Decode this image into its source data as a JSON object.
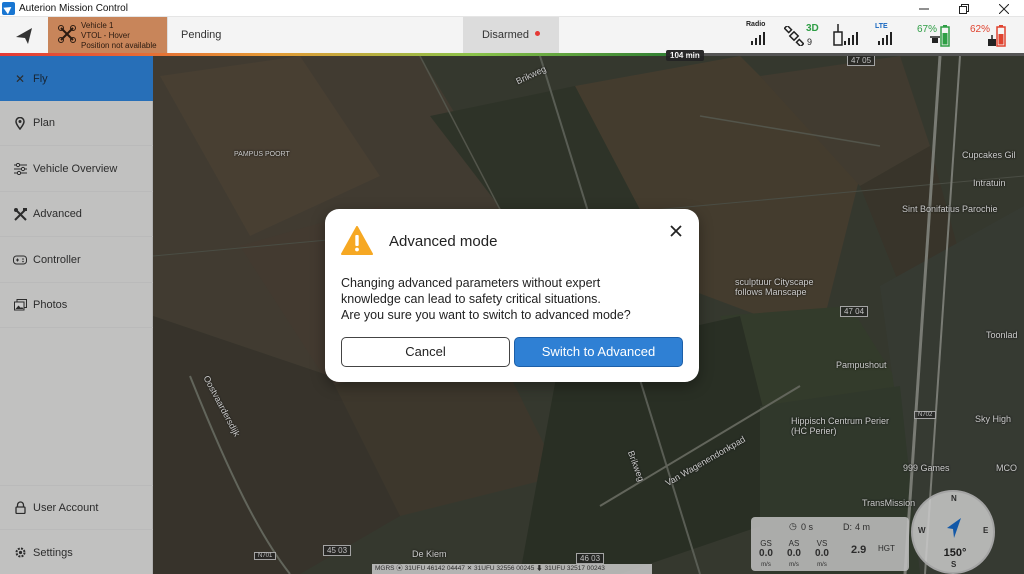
{
  "window": {
    "title": "Auterion Mission Control",
    "controls": [
      "minimize-icon",
      "restore-icon",
      "close-icon"
    ]
  },
  "toolbar": {
    "vehicle": {
      "name": "Vehicle 1",
      "mode": "VTOL - Hover",
      "position": "Position not available"
    },
    "status": "Pending",
    "armed": "Disarmed",
    "flight_time": "104 min",
    "indicators": {
      "radio_label": "Radio",
      "gps_fix": "3D",
      "gps_sats": "9",
      "lte_label": "LTE",
      "vehicle_battery": "67%",
      "controller_battery": "62%"
    },
    "colors": {
      "vehicle_bg": "#c8855a",
      "armed_dot": "#e53935",
      "vehicle_battery": "#2e9e45",
      "controller_battery": "#e0432f"
    }
  },
  "sidebar": {
    "items": [
      {
        "label": "Fly",
        "icon": "drone-icon",
        "active": true
      },
      {
        "label": "Plan",
        "icon": "map-pin-icon"
      },
      {
        "label": "Vehicle Overview",
        "icon": "sliders-icon"
      },
      {
        "label": "Advanced",
        "icon": "tools-icon"
      },
      {
        "label": "Controller",
        "icon": "gamepad-icon"
      },
      {
        "label": "Photos",
        "icon": "photos-icon"
      }
    ],
    "bottom_items": [
      {
        "label": "User Account",
        "icon": "lock-icon"
      },
      {
        "label": "Settings",
        "icon": "gear-icon"
      }
    ],
    "active_color": "#2d7fd2"
  },
  "map": {
    "labels": [
      "Brikweg",
      "PAMPUS POORT",
      "Cupcakes Gil",
      "Intratuin",
      "Sint Bonifatius Parochie",
      "sculptuur Cityscape follows Manscape",
      "Pampushout",
      "Toonlad",
      "Hippisch Centrum Perier (HC Perier)",
      "Sky High",
      "999 Games",
      "MCO",
      "TransMission",
      "Van Wagenendonkpad",
      "Brikweg",
      "De Kiem",
      "Oostvaardersdijk"
    ],
    "road_badges": [
      "47 05",
      "47 04",
      "45 03",
      "46 03",
      "N702",
      "N701"
    ]
  },
  "dialog": {
    "title": "Advanced mode",
    "body": [
      "Changing advanced parameters without expert",
      "knowledge can lead to safety critical situations.",
      "Are you sure you want to switch to advanced mode?"
    ],
    "cancel_label": "Cancel",
    "confirm_label": "Switch to Advanced"
  },
  "telemetry": {
    "timer": "0 s",
    "distance_label": "D:",
    "distance": "4 m",
    "gs_label": "GS",
    "gs": "0.0",
    "gs_unit": "m/s",
    "as_label": "AS",
    "as": "0.0",
    "as_unit": "m/s",
    "vs_label": "VS",
    "vs": "0.0",
    "vs_unit": "m/s",
    "hgt_value": "2.9",
    "hgt_label": "HGT"
  },
  "compass": {
    "heading": "150°",
    "n": "N",
    "e": "E",
    "s": "S",
    "w": "W"
  },
  "coords": "MGRS ⦿ 31UFU 46142 04447  ✕ 31UFU 32556 00245  ⬇ 31UFU 32517 00243"
}
